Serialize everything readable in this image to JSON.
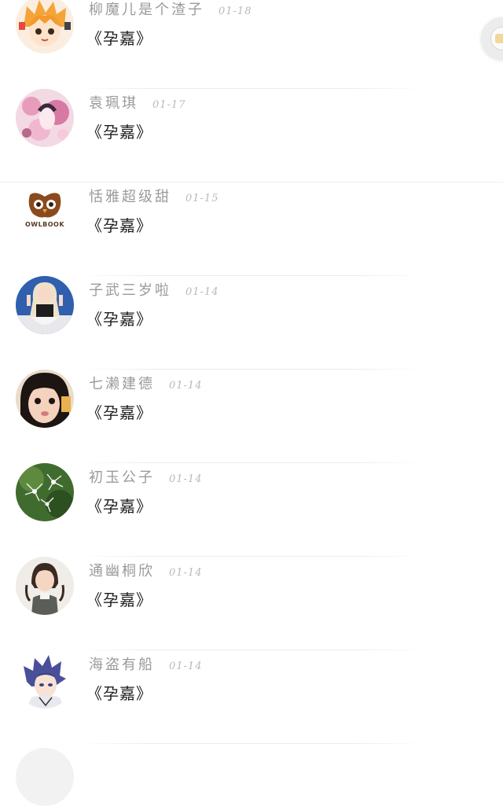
{
  "comments": [
    {
      "name": "柳魔儿是个渣子",
      "date": "01-18",
      "message": "《孕嘉》"
    },
    {
      "name": "袁珮琪",
      "date": "01-17",
      "message": "《孕嘉》"
    },
    {
      "name": "恬雅超级甜",
      "date": "01-15",
      "message": "《孕嘉》",
      "avatar_text": "OWLBOOK"
    },
    {
      "name": "子武三岁啦",
      "date": "01-14",
      "message": "《孕嘉》"
    },
    {
      "name": "七濑建德",
      "date": "01-14",
      "message": "《孕嘉》"
    },
    {
      "name": "初玉公子",
      "date": "01-14",
      "message": "《孕嘉》"
    },
    {
      "name": "通幽桐欣",
      "date": "01-14",
      "message": "《孕嘉》"
    },
    {
      "name": "海盗有船",
      "date": "01-14",
      "message": "《孕嘉》"
    }
  ],
  "colors": {
    "name": "#9a9a9a",
    "date": "#b9b9b9",
    "message": "#1e1e1e",
    "divider": "#ececec"
  }
}
